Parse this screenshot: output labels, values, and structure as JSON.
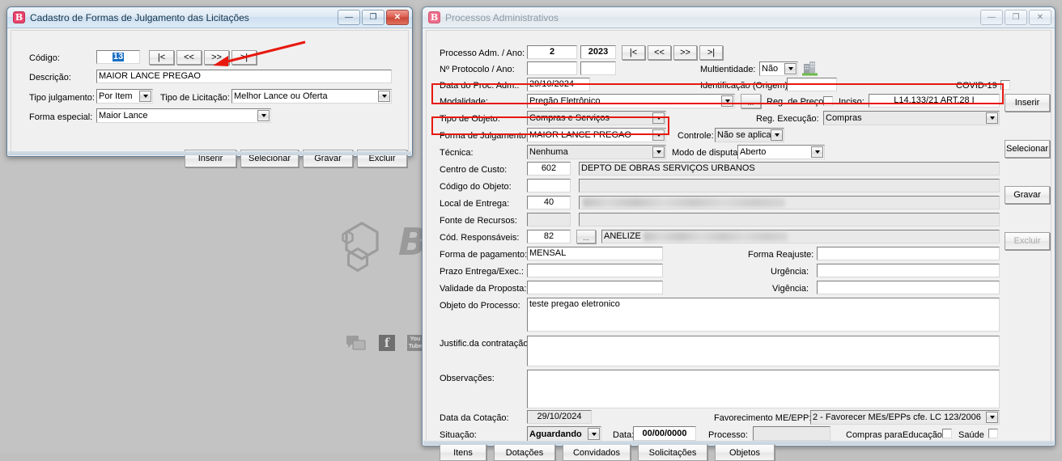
{
  "colors": {
    "highlight": "#e8180f",
    "selection": "#1a6ec4",
    "app_icon": "#e8446b"
  },
  "desktop": {
    "watermark_letter": "B",
    "social_icons": [
      "chat-icon",
      "facebook-icon",
      "youtube-icon"
    ],
    "facebook_glyph": "f",
    "youtube_glyph_top": "You",
    "youtube_glyph_bottom": "Tube"
  },
  "window1": {
    "title": "Cadastro de Formas de Julgamento das Licitações",
    "icon_letter": "B",
    "controls": {
      "minimize": "—",
      "maximize": "❐",
      "close": "✕"
    },
    "fields": [
      {
        "label": "Código:",
        "value": "13"
      },
      {
        "label": "Descrição:",
        "value": "MAIOR LANCE PREGAO"
      },
      {
        "label": "Tipo julgamento:",
        "value": "Por Item"
      },
      {
        "label": "Tipo de Licitação:",
        "value": "Melhor Lance ou Oferta"
      },
      {
        "label": "Forma especial:",
        "value": "Maior Lance"
      }
    ],
    "nav_buttons": [
      "|<",
      "<<",
      ">>",
      ">|"
    ],
    "action_buttons": [
      {
        "label": "Inserir",
        "accel": "I"
      },
      {
        "label": "Selecionar",
        "accel": "S"
      },
      {
        "label": "Gravar",
        "accel": "G"
      },
      {
        "label": "Excluir",
        "accel": "E"
      }
    ]
  },
  "window2": {
    "title": "Processos Administrativos",
    "icon_letter": "B",
    "controls": {
      "minimize": "—",
      "maximize": "❐",
      "close": "✕"
    },
    "nav_buttons": [
      "|<",
      "<<",
      ">>",
      ">|"
    ],
    "labels": {
      "processo_ano": "Processo Adm. / Ano:",
      "protocolo_ano": "Nº Protocolo / Ano:",
      "data_proc": "Data do Proc. Adm.:",
      "modalidade": "Modalidade:",
      "tipo_objeto": "Tipo de Objeto:",
      "forma_julgamento": "Forma de Julgamento:",
      "tecnica": "Técnica:",
      "centro_custo": "Centro de Custo:",
      "codigo_objeto": "Código do Objeto:",
      "local_entrega": "Local de Entrega:",
      "fonte_recursos": "Fonte de Recursos:",
      "cod_responsaveis": "Cód. Responsáveis:",
      "forma_pagamento": "Forma de pagamento:",
      "prazo_entrega": "Prazo Entrega/Exec.:",
      "validade_proposta": "Validade da Proposta:",
      "objeto_processo": "Objeto do Processo:",
      "justific_contratacao": "Justific.da contratação:",
      "observacoes": "Observações:",
      "data_cotacao": "Data da Cotação:",
      "situacao": "Situação:",
      "multientidade": "Multientidade:",
      "identificacao_origem": "Identificação (Origem):",
      "covid19": "COVID-19",
      "reg_preco": "Reg. de Preço",
      "inciso": "Inciso:",
      "reg_execucao": "Reg. Execução:",
      "controle": "Controle:",
      "modo_disputa": "Modo de disputa:",
      "forma_reajuste": "Forma Reajuste:",
      "urgencia": "Urgência:",
      "vigencia": "Vigência:",
      "favorecimento": "Favorecimento ME/EPP:",
      "data": "Data:",
      "processo": "Processo:",
      "compras_para": "Compras para:",
      "educacao": "Educação",
      "saude": "Saúde"
    },
    "values": {
      "processo": "2",
      "ano": "2023",
      "protocolo": "",
      "protocolo_ano": "",
      "data_proc": "29/10/2024",
      "multientidade": "Não",
      "identificacao_origem": "",
      "modalidade": "Pregão Eletrônico",
      "inciso": "L14.133/21 ART.28 I",
      "tipo_objeto": "Compras e Serviços",
      "reg_execucao": "Compras",
      "forma_julgamento": "MAIOR LANCE PREGAO",
      "controle": "Não se aplica",
      "tecnica": "Nenhuma",
      "modo_disputa": "Aberto",
      "centro_custo_cod": "602",
      "centro_custo_desc": "DEPTO DE OBRAS SERVIÇOS URBANOS",
      "codigo_objeto_cod": "",
      "codigo_objeto_desc": "",
      "local_entrega_cod": "40",
      "local_entrega_desc": "",
      "fonte_recursos_cod": "",
      "fonte_recursos_desc": "",
      "cod_responsaveis_cod": "82",
      "cod_responsaveis_desc": "ANELIZE",
      "forma_pagamento": "MENSAL",
      "forma_reajuste": "",
      "prazo_entrega": "",
      "urgencia": "",
      "validade_proposta": "",
      "vigencia": "",
      "objeto_processo": "teste pregao eletronico",
      "justific_contratacao": "",
      "observacoes": "",
      "data_cotacao": "29/10/2024",
      "favorecimento": "2 - Favorecer MEs/EPPs cfe. LC 123/2006",
      "situacao": "Aguardando",
      "data": "00/00/0000",
      "processo_sit": ""
    },
    "side_buttons": [
      {
        "label": "Inserir",
        "accel": "I",
        "disabled": false
      },
      {
        "label": "Selecionar",
        "accel": "S",
        "disabled": false
      },
      {
        "label": "Gravar",
        "accel": "G",
        "disabled": false
      },
      {
        "label": "Excluir",
        "accel": "E",
        "disabled": true
      }
    ],
    "bottom_buttons": [
      {
        "label": "Itens",
        "accel": "t"
      },
      {
        "label": "Dotações",
        "accel": "D"
      },
      {
        "label": "Convidados",
        "accel": "C"
      },
      {
        "label": "Solicitações",
        "accel": "o"
      },
      {
        "label": "Objetos",
        "accel": "b"
      }
    ],
    "ellipsis_label": "..."
  }
}
